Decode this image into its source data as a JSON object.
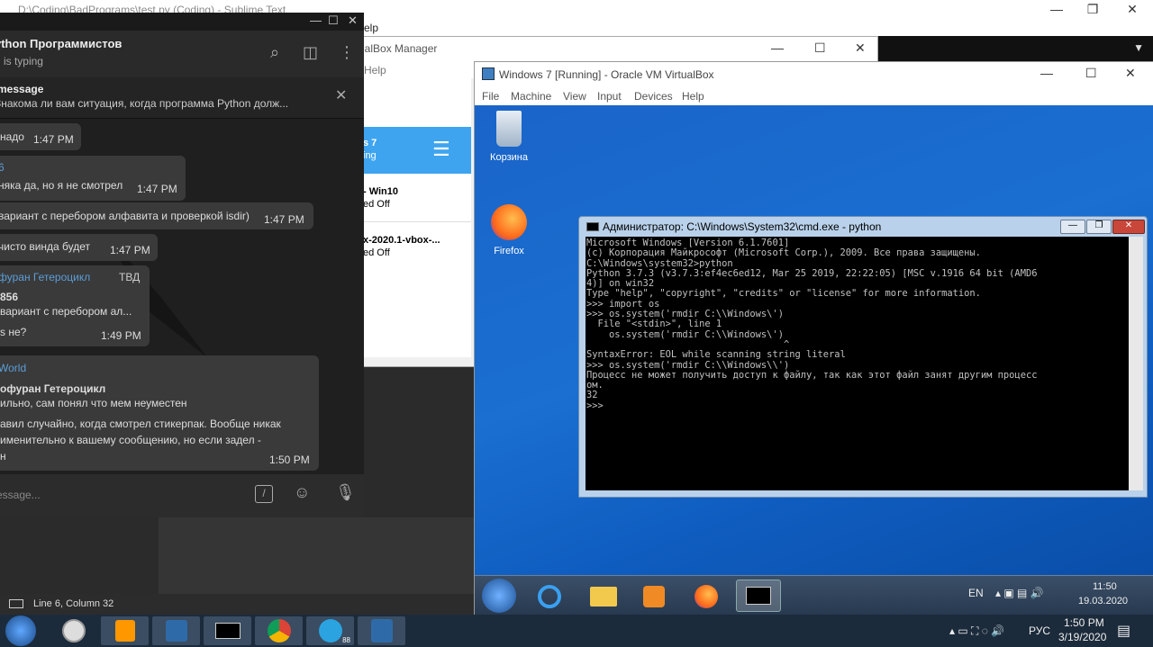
{
  "sublime": {
    "title": "D:\\Coding\\BadPrograms\\test.py (Coding) - Sublime Text",
    "menu_fragment": "elp",
    "status": "Line 6, Column 32"
  },
  "vbox_manager": {
    "title": "ualBox Manager",
    "menu_help": "Help",
    "items": [
      {
        "name": "s 7",
        "state": "ing"
      },
      {
        "name": "- Win10",
        "state": "ed Off"
      },
      {
        "name": "x-2020.1-vbox-...",
        "state": "ed Off"
      }
    ]
  },
  "telegram": {
    "chat_name": "ython Программистов",
    "chat_status": "н is typing",
    "pinned_header": "message",
    "pinned_preview": "Знакома ли вам ситуация, когда программа Python долж...",
    "messages": [
      {
        "text": "надо",
        "time": "1:47 PM"
      },
      {
        "sender": "6",
        "text": "няка да, но я не смотрел",
        "time": "1:47 PM"
      },
      {
        "text": "вариант с перебором алфавита и проверкой isdir)",
        "time": "1:47 PM"
      },
      {
        "text": "чисто винда будет",
        "time": "1:47 PM"
      },
      {
        "sender": "фуран Гетероцикл",
        "tag": "ТВД",
        "quote_author": "856",
        "quote_text": "вариант с перебором ал...",
        "text": "s не?",
        "time": "1:49 PM"
      },
      {
        "sender": "World",
        "quote_author": "офуран Гетероцикл",
        "quote_text": "ильно, сам понял что мем неуместен",
        "line1": "авил случайно, когда смотрел стикерпак. Вообще никак",
        "line2": "именительно к вашему сообщению, но если задел -",
        "line3": "н",
        "time": "1:50 PM"
      }
    ],
    "input_placeholder": "essage..."
  },
  "vm": {
    "title": "Windows 7 [Running] - Oracle VM VirtualBox",
    "menu": [
      "File",
      "Machine",
      "View",
      "Input",
      "Devices",
      "Help"
    ],
    "desktop_icons": [
      "Корзина",
      "Firefox"
    ],
    "tray_lang": "EN",
    "clock_time": "11:50",
    "clock_date": "19.03.2020"
  },
  "cmd": {
    "title": "Администратор: C:\\Windows\\System32\\cmd.exe - python",
    "lines": [
      "Microsoft Windows [Version 6.1.7601]",
      "(c) Корпорация Майкрософт (Microsoft Corp.), 2009. Все права защищены.",
      "",
      "C:\\Windows\\system32>python",
      "Python 3.7.3 (v3.7.3:ef4ec6ed12, Mar 25 2019, 22:22:05) [MSC v.1916 64 bit (AMD6",
      "4)] on win32",
      "Type \"help\", \"copyright\", \"credits\" or \"license\" for more information.",
      ">>> import os",
      ">>> os.system('rmdir C:\\\\Windows\\')",
      "  File \"<stdin>\", line 1",
      "    os.system('rmdir C:\\\\Windows\\')",
      "                                   ^",
      "SyntaxError: EOL while scanning string literal",
      ">>> os.system('rmdir C:\\\\Windows\\\\')",
      "Процесс не может получить доступ к файлу, так как этот файл занят другим процесс",
      "ом.",
      "32",
      ">>>"
    ]
  },
  "host": {
    "lang": "РУС",
    "time": "1:50 PM",
    "date": "3/19/2020",
    "badge": "88"
  }
}
